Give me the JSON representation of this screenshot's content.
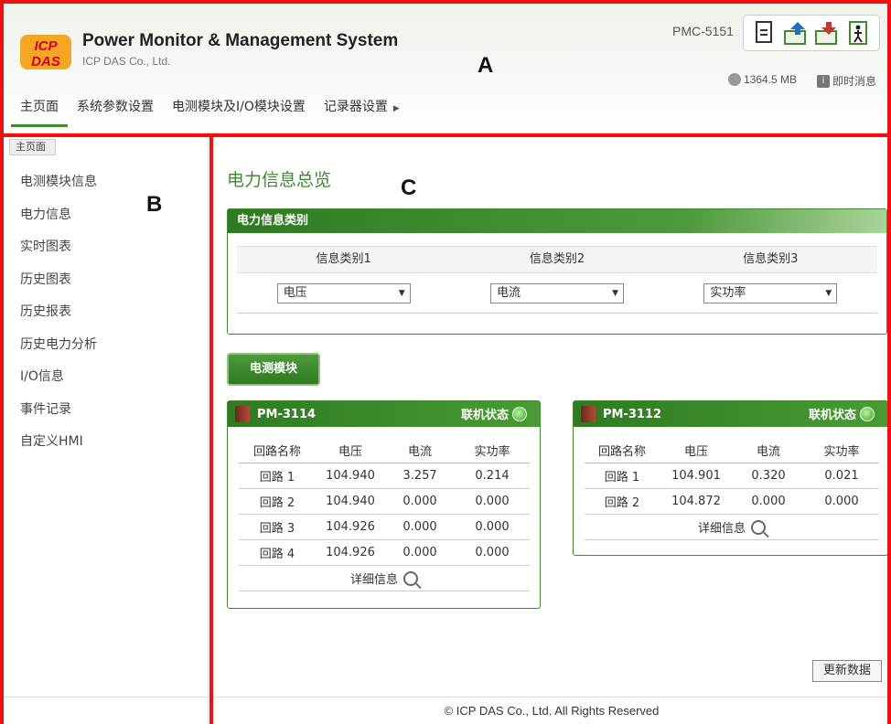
{
  "header": {
    "app_title": "Power Monitor & Management System",
    "company": "ICP DAS Co., Ltd.",
    "model": "PMC-5151",
    "memory": "1364.5 MB",
    "message": "即时消息",
    "toolbar_icons": [
      "document-icon",
      "upload-icon",
      "download-icon",
      "logout-icon"
    ]
  },
  "nav": {
    "items": [
      "主页面",
      "系统参数设置",
      "电测模块及I/O模块设置",
      "记录器设置"
    ],
    "active": "主页面"
  },
  "sidebar": {
    "breadcrumb": "主页面",
    "items": [
      "电测模块信息",
      "电力信息",
      "实时图表",
      "历史图表",
      "历史报表",
      "历史电力分析",
      "I/O信息",
      "事件记录",
      "自定义HMI"
    ]
  },
  "main": {
    "title": "电力信息总览",
    "category_panel": {
      "header": "电力信息类别",
      "columns": [
        "信息类别1",
        "信息类别2",
        "信息类别3"
      ],
      "selected": [
        "电压",
        "电流",
        "实功率"
      ]
    },
    "module_button": "电测模块",
    "cards": [
      {
        "name": "PM-3114",
        "status_label": "联机状态",
        "columns": [
          "回路名称",
          "电压",
          "电流",
          "实功率"
        ],
        "rows": [
          [
            "回路 1",
            "104.940",
            "3.257",
            "0.214"
          ],
          [
            "回路 2",
            "104.940",
            "0.000",
            "0.000"
          ],
          [
            "回路 3",
            "104.926",
            "0.000",
            "0.000"
          ],
          [
            "回路 4",
            "104.926",
            "0.000",
            "0.000"
          ]
        ],
        "detail": "详细信息"
      },
      {
        "name": "PM-3112",
        "status_label": "联机状态",
        "columns": [
          "回路名称",
          "电压",
          "电流",
          "实功率"
        ],
        "rows": [
          [
            "回路 1",
            "104.901",
            "0.320",
            "0.021"
          ],
          [
            "回路 2",
            "104.872",
            "0.000",
            "0.000"
          ]
        ],
        "detail": "详细信息"
      }
    ],
    "update_button": "更新数据",
    "footer": "© ICP DAS Co., Ltd. All Rights Reserved"
  },
  "annotations": {
    "a": "A",
    "b": "B",
    "c": "C",
    "color": "#ee1111"
  },
  "colors": {
    "accent_green": "#3e8a2d",
    "status_led": "#3aa528"
  }
}
